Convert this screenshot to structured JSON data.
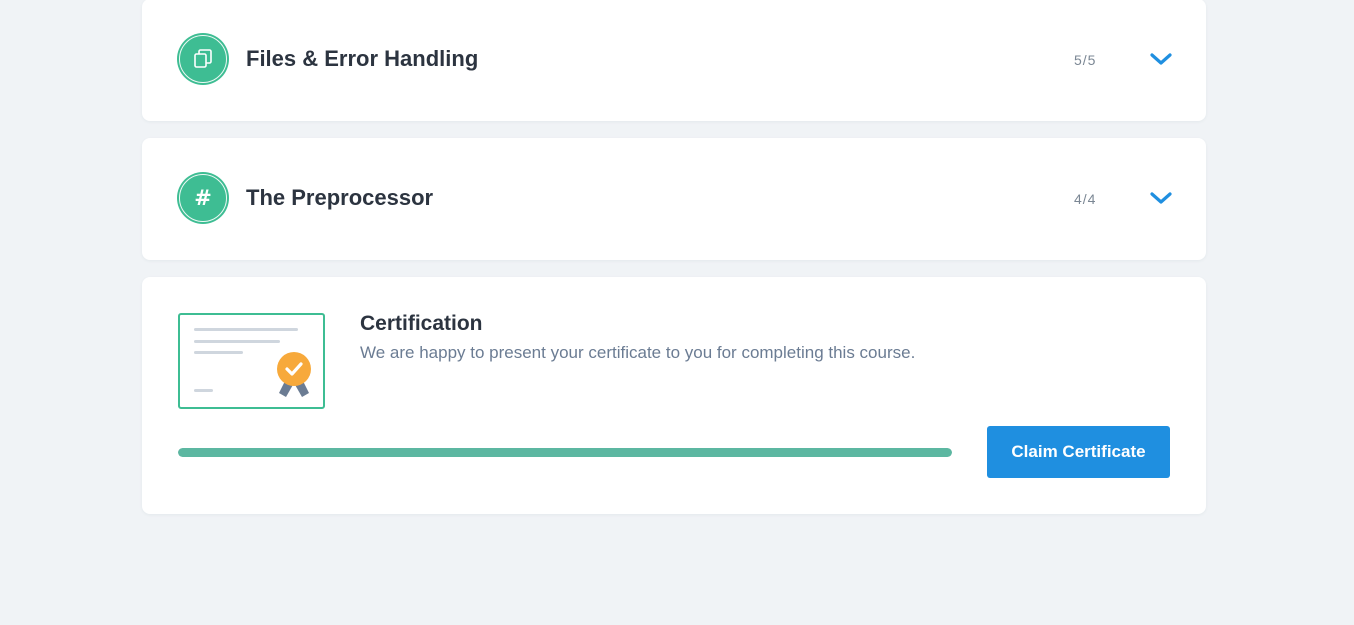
{
  "modules": [
    {
      "title": "Files & Error Handling",
      "progress": "5/5",
      "icon": "files-icon"
    },
    {
      "title": "The Preprocessor",
      "progress": "4/4",
      "icon": "hash-icon",
      "icon_glyph": "#"
    }
  ],
  "certification": {
    "title": "Certification",
    "description": "We are happy to present your certificate to you for completing this course.",
    "progress_fraction": 1.0,
    "button_label": "Claim Certificate",
    "icon": "certificate-icon"
  },
  "colors": {
    "background": "#f0f3f6",
    "module_icon": "#3ebd93",
    "chevron": "#1f8fe0",
    "progress_fill": "#5cb7a1",
    "button": "#1f8fe0",
    "badge": "#f7a93b",
    "ribbon": "#6b7c93"
  }
}
